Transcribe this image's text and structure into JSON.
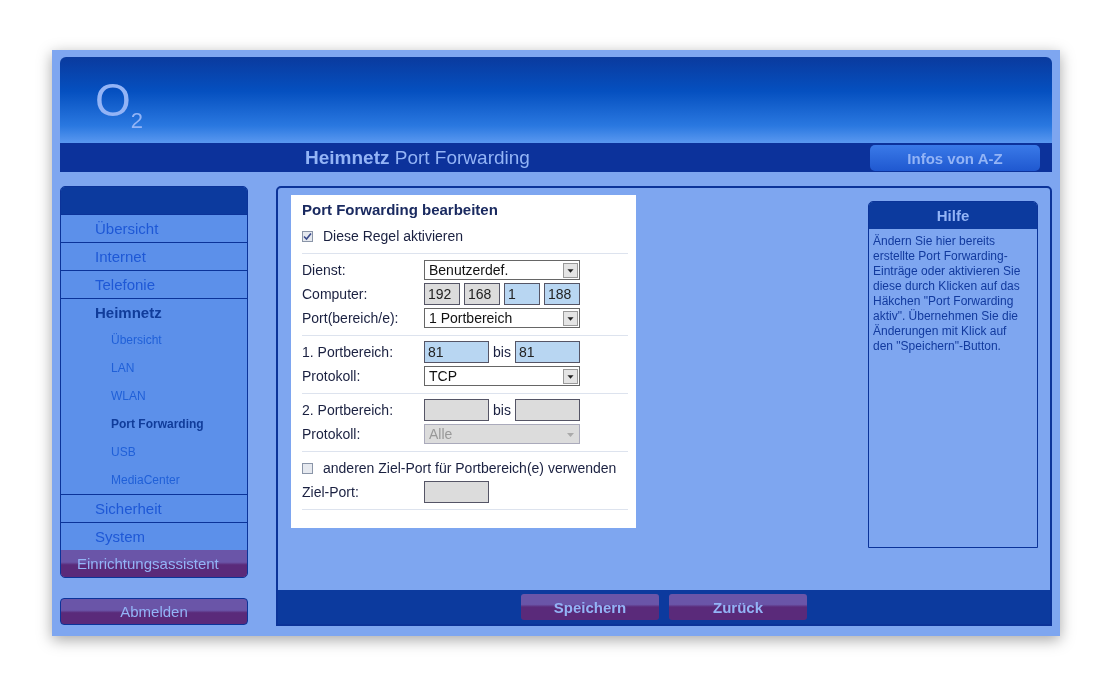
{
  "header": {
    "logo": "O$_{2}$",
    "title": "**Heimnetz** Port Forwarding",
    "info_button": "Infos von A-Z"
  },
  "sidebar": {
    "items": [
      {
        "label": "Übersicht",
        "kind": "section",
        "selected": false
      },
      {
        "label": "Internet",
        "kind": "section",
        "selected": false
      },
      {
        "label": "Telefonie",
        "kind": "section",
        "selected": false
      },
      {
        "label": "Heimnetz",
        "kind": "section",
        "selected": true,
        "expanded": true,
        "children": [
          {
            "label": "Übersicht",
            "selected": false
          },
          {
            "label": "LAN",
            "selected": false
          },
          {
            "label": "WLAN",
            "selected": false
          },
          {
            "label": "Port Forwarding",
            "selected": true
          },
          {
            "label": "USB",
            "selected": false
          },
          {
            "label": "MediaCenter",
            "selected": false
          }
        ]
      },
      {
        "label": "Sicherheit",
        "kind": "section",
        "selected": false
      },
      {
        "label": "System",
        "kind": "section",
        "selected": false
      },
      {
        "label": "Einrichtungsassistent",
        "kind": "wizard"
      }
    ],
    "logout_button": "Abmelden"
  },
  "form": {
    "title": "Port Forwarding bearbeiten",
    "sections": [
      {
        "rows": [
          {
            "kind": "checkbox",
            "label": "Diese Regel aktivieren",
            "checked": true
          }
        ]
      },
      {
        "rows": [
          {
            "kind": "select",
            "label": "Dienst:",
            "value": "Benutzerdef.",
            "disabled": false
          },
          {
            "kind": "ip",
            "label": "Computer:",
            "octets": [
              {
                "value": "192",
                "editable": false
              },
              {
                "value": "168",
                "editable": false
              },
              {
                "value": "1",
                "editable": true
              },
              {
                "value": "188",
                "editable": true
              }
            ]
          },
          {
            "kind": "select",
            "label": "Port(bereich/e):",
            "value": "1 Portbereich",
            "disabled": false
          }
        ]
      },
      {
        "rows": [
          {
            "kind": "range",
            "label": "1. Portbereich:",
            "from": "81",
            "separator": "bis",
            "to": "81",
            "disabled": false
          },
          {
            "kind": "select",
            "label": "Protokoll:",
            "value": "TCP",
            "disabled": false
          }
        ]
      },
      {
        "rows": [
          {
            "kind": "range",
            "label": "2. Portbereich:",
            "separator": "bis",
            "disabled": true
          },
          {
            "kind": "select",
            "label": "Protokoll:",
            "value": "Alle",
            "disabled": true
          }
        ]
      },
      {
        "rows": [
          {
            "kind": "checkbox",
            "label": "anderen Ziel-Port für Portbereich(e) verwenden",
            "checked": false
          },
          {
            "kind": "input",
            "label": "Ziel-Port:",
            "disabled": true
          }
        ]
      }
    ]
  },
  "help": {
    "title": "Hilfe",
    "text": "Ändern Sie hier bereits erstellte Port Forwarding-Einträge oder aktivieren Sie diese durch Klicken auf das Häkchen \"Port Forwarding aktiv\". Übernehmen Sie die Änderungen mit Klick auf den \"Speichern\"-Button."
  },
  "footer": {
    "buttons": [
      "Speichern",
      "Zurück"
    ]
  }
}
